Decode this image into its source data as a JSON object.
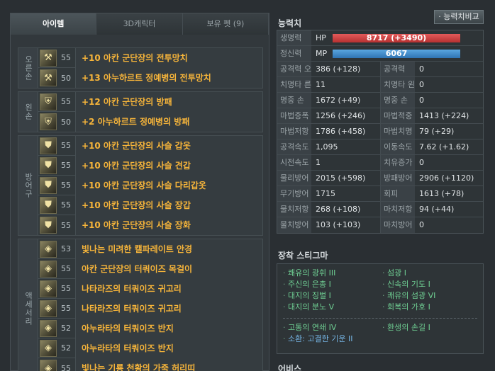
{
  "tabs": [
    "아이템",
    "3D캐릭터",
    "보유 펫 (9)"
  ],
  "equipment": [
    {
      "label": "오른손",
      "items": [
        {
          "level": "55",
          "name": "+10 아칸 군단장의 전투망치"
        },
        {
          "level": "50",
          "name": "+13 아누하르트 정예병의 전투망치"
        }
      ]
    },
    {
      "label": "왼손",
      "items": [
        {
          "level": "55",
          "name": "+12 아칸 군단장의 방패"
        },
        {
          "level": "50",
          "name": "+2 아누하르트 정예병의 방패"
        }
      ]
    },
    {
      "label": "방어구",
      "items": [
        {
          "level": "55",
          "name": "+10 아칸 군단장의 사슬 갑옷"
        },
        {
          "level": "55",
          "name": "+10 아칸 군단장의 사슬 견갑"
        },
        {
          "level": "55",
          "name": "+10 아칸 군단장의 사슬 다리갑옷"
        },
        {
          "level": "55",
          "name": "+10 아칸 군단장의 사슬 장갑"
        },
        {
          "level": "55",
          "name": "+10 아칸 군단장의 사슬 장화"
        }
      ]
    },
    {
      "label": "액세서리",
      "items": [
        {
          "level": "53",
          "name": "빛나는 미려한 캘파레이트 안경"
        },
        {
          "level": "55",
          "name": "아칸 군단장의 터쿼이즈 목걸이"
        },
        {
          "level": "55",
          "name": "나타라즈의 터쿼이즈 귀고리"
        },
        {
          "level": "55",
          "name": "나타라즈의 터쿼이즈 귀고리"
        },
        {
          "level": "52",
          "name": "아누라타의 터쿼이즈 반지"
        },
        {
          "level": "52",
          "name": "아누라타의 터쿼이즈 반지"
        },
        {
          "level": "55",
          "name": "빛나는 기룡 천황의 가죽 허리띠"
        }
      ]
    }
  ],
  "stats": {
    "title": "능력치",
    "compare_button": "· 능력치비교",
    "hp": {
      "key": "생명력",
      "label": "HP",
      "value": "8717 (+3490)"
    },
    "mp": {
      "key": "정신력",
      "label": "MP",
      "value": "6067"
    },
    "rows": [
      {
        "k1": "공격력 오",
        "v1": "386 (+128)",
        "k2": "공격력",
        "v2": "0"
      },
      {
        "k1": "치명타 른",
        "v1": "11",
        "k2": "치명타 왼",
        "v2": "0"
      },
      {
        "k1": "명중 손",
        "v1": "1672 (+49)",
        "k2": "명중 손",
        "v2": "0"
      },
      {
        "k1": "마법증폭",
        "v1": "1256 (+246)",
        "k2": "마법적중",
        "v2": "1413 (+224)"
      },
      {
        "k1": "마법저항",
        "v1": "1786 (+458)",
        "k2": "마법치명",
        "v2": "79 (+29)"
      },
      {
        "k1": "공격속도",
        "v1": "1,095",
        "k2": "이동속도",
        "v2": "7.62 (+1.62)"
      },
      {
        "k1": "시전속도",
        "v1": "1",
        "k2": "치유증가",
        "v2": "0"
      },
      {
        "k1": "물리방어",
        "v1": "2015 (+598)",
        "k2": "방패방어",
        "v2": "2906 (+1120)"
      },
      {
        "k1": "무기방어",
        "v1": "1715",
        "k2": "회피",
        "v2": "1613 (+78)"
      },
      {
        "k1": "물치저항",
        "v1": "268 (+108)",
        "k2": "마치저항",
        "v2": "94 (+44)"
      },
      {
        "k1": "물치방어",
        "v1": "103 (+103)",
        "k2": "마치방어",
        "v2": "0"
      }
    ]
  },
  "stigma": {
    "title": "장착 스티그마",
    "left": [
      "쾌유의 광휘 III",
      "주신의 은총 I",
      "대지의 징벌 I",
      "대지의 분노 V"
    ],
    "right": [
      "섬광 I",
      "신속의 기도 I",
      "쾌유의 섬광 VI",
      "회복의 가호 I"
    ],
    "advanced_left": [
      "고통의 연쇄 IV",
      "소환: 고결한 기운 II"
    ],
    "advanced_right": [
      "환생의 손길 I"
    ]
  },
  "abyss": {
    "title": "어비스"
  }
}
